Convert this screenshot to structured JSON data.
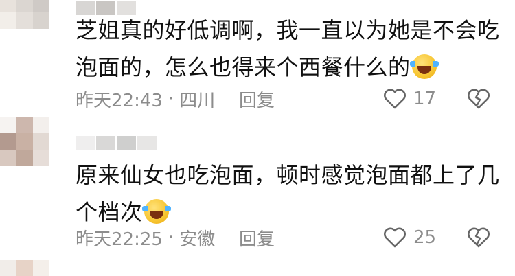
{
  "comments": [
    {
      "text": "芝姐真的好低调啊，我一直以为她是不会吃泡面的，怎么也得来个西餐什么的",
      "emoji": "laughing-crying-emoji",
      "time": "昨天22:43",
      "separator": "·",
      "location": "四川",
      "reply_label": "回复",
      "likes": "17"
    },
    {
      "text": "原来仙女也吃泡面，顿时感觉泡面都上了几个档次",
      "emoji": "laughing-crying-emoji",
      "time": "昨天22:25",
      "separator": "·",
      "location": "安徽",
      "reply_label": "回复",
      "likes": "25"
    }
  ],
  "colors": {
    "text": "#111111",
    "meta": "#8c8c8c",
    "background": "#ffffff"
  },
  "icons": {
    "like": "heart-outline-icon",
    "dislike": "broken-heart-icon"
  }
}
